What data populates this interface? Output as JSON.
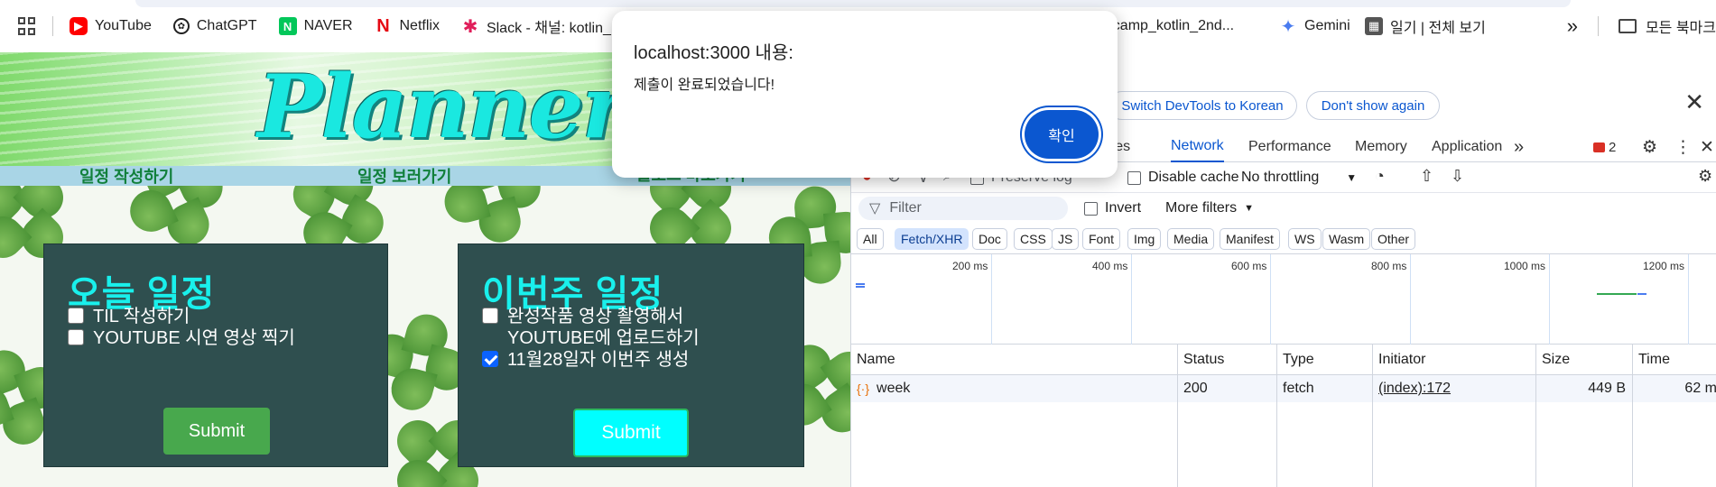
{
  "bookmarks": {
    "items": [
      {
        "label": "YouTube",
        "icon": "youtube-icon"
      },
      {
        "label": "ChatGPT",
        "icon": "chatgpt-icon"
      },
      {
        "label": "NAVER",
        "icon": "naver-icon"
      },
      {
        "label": "Netflix",
        "icon": "netflix-icon"
      },
      {
        "label": "Slack - 채널: kotlin_...",
        "icon": "slack-icon"
      },
      {
        "label": "nbcamp_kotlin_2nd...",
        "icon": "github-icon"
      },
      {
        "label": "Gemini",
        "icon": "gemini-icon"
      },
      {
        "label": "일기 | 전체 보기",
        "icon": "diary-icon"
      }
    ],
    "overflow": "»",
    "all_bookmarks": "모든 북마크"
  },
  "page": {
    "title": "Planner",
    "nav": [
      "일정 작성하기",
      "일정 보러가기",
      "블로그 바로가기"
    ],
    "today": {
      "heading": "오늘 일정",
      "tasks": [
        {
          "label": "TIL 작성하기",
          "checked": false
        },
        {
          "label": "YOUTUBE 시연 영상 찍기",
          "checked": false
        }
      ],
      "submit": "Submit"
    },
    "week": {
      "heading": "이번주 일정",
      "tasks": [
        {
          "label": "완성작품 영상 촬영해서 YOUTUBE에 업로드하기",
          "checked": false
        },
        {
          "label": "11월28일자 이번주 생성",
          "checked": true
        }
      ],
      "submit": "Submit"
    }
  },
  "alert": {
    "title": "localhost:3000 내용:",
    "message": "제출이 완료되었습니다!",
    "ok": "확인"
  },
  "devtools": {
    "lang_switch": "Switch DevTools to Korean",
    "dont_show": "Don't show again",
    "tabs": [
      "urces",
      "Network",
      "Performance",
      "Memory",
      "Application"
    ],
    "active_tab": "Network",
    "error_count": "2",
    "toolbar": {
      "preserve_log": "Preserve log",
      "disable_cache": "Disable cache",
      "throttling": "No throttling"
    },
    "filter": {
      "placeholder": "Filter",
      "invert": "Invert",
      "more_filters": "More filters"
    },
    "types": [
      "All",
      "Fetch/XHR",
      "Doc",
      "CSS",
      "JS",
      "Font",
      "Img",
      "Media",
      "Manifest",
      "WS",
      "Wasm",
      "Other"
    ],
    "active_type": "Fetch/XHR",
    "timeline_ticks": [
      "200 ms",
      "400 ms",
      "600 ms",
      "800 ms",
      "1000 ms",
      "1200 ms"
    ],
    "columns": [
      "Name",
      "Status",
      "Type",
      "Initiator",
      "Size",
      "Time"
    ],
    "rows": [
      {
        "name": "week",
        "status": "200",
        "type": "fetch",
        "initiator": "(index):172",
        "size": "449 B",
        "time": "62 m"
      }
    ]
  }
}
